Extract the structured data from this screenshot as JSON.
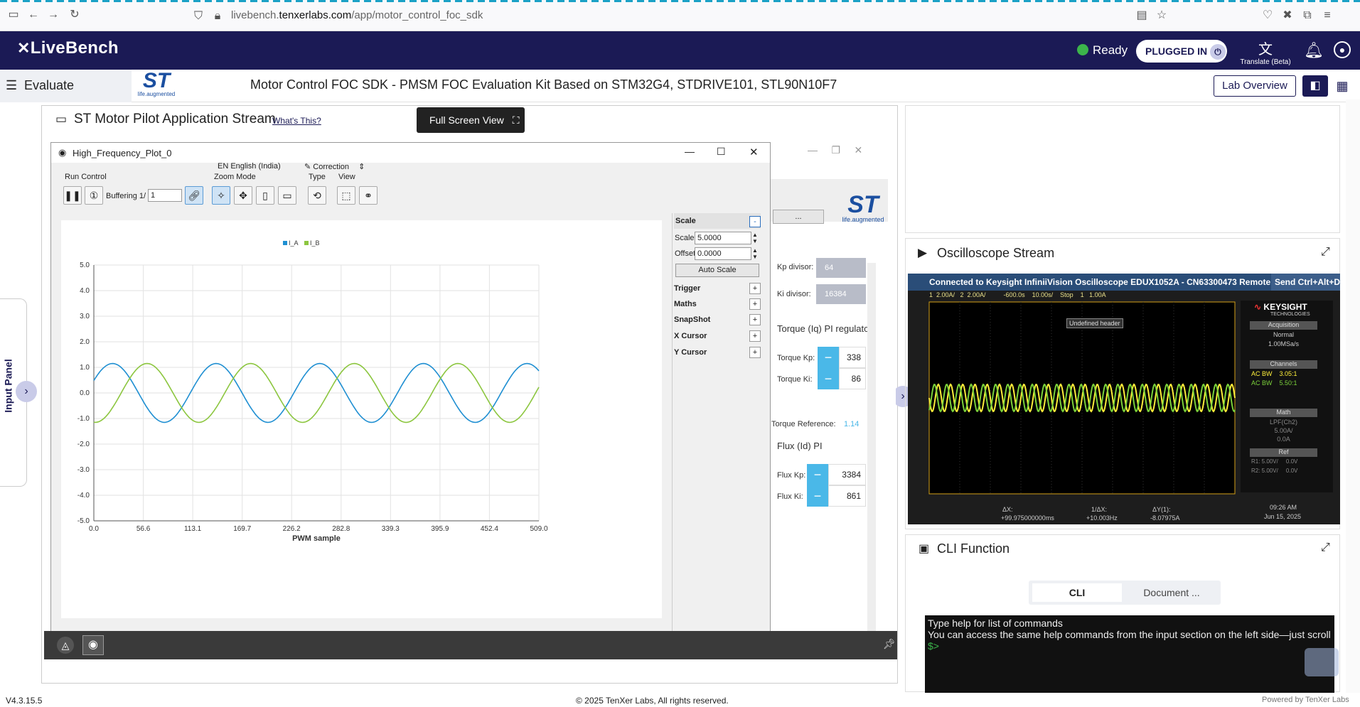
{
  "browser": {
    "url_prefix": "livebench.",
    "url_domain": "tenxerlabs.com",
    "url_path": "/app/motor_control_foc_sdk"
  },
  "header": {
    "logo": "LiveBench",
    "status": "Ready",
    "plugged": "PLUGGED IN",
    "translate": "Translate (Beta)"
  },
  "subheader": {
    "section": "Evaluate",
    "st_tagline": "life.augmented",
    "title": "Motor Control FOC SDK - PMSM FOC Evaluation Kit Based on STM32G4, STDRIVE101, STL90N10F7",
    "lab_overview": "Lab Overview"
  },
  "stream": {
    "title": "ST Motor Pilot Application Stream",
    "whats_this": "What's This?",
    "full_screen": "Full Screen View",
    "input_panel": "Input Panel"
  },
  "plot_window": {
    "title": "High_Frequency_Plot_0",
    "language": "EN English (India)",
    "correction": "Correction",
    "groups": {
      "run": "Run Control",
      "zoom": "Zoom Mode",
      "type": "Type",
      "view": "View"
    },
    "buffering_label": "Buffering 1/",
    "buffering_value": "1",
    "scale_panel": {
      "header": "Scale",
      "scale_label": "Scale",
      "scale_value": "5.0000",
      "offset_label": "Offset",
      "offset_value": "0.0000",
      "auto_scale": "Auto Scale",
      "sections": [
        "Trigger",
        "Maths",
        "SnapShot",
        "X Cursor",
        "Y Cursor"
      ]
    }
  },
  "chart_data": {
    "type": "line",
    "xlabel": "PWM sample",
    "ylabel": "",
    "xlim": [
      0,
      509
    ],
    "ylim": [
      -5,
      5
    ],
    "x_ticks": [
      "0.0",
      "56.6",
      "113.1",
      "169.7",
      "226.2",
      "282.8",
      "339.3",
      "395.9",
      "452.4",
      "509.0"
    ],
    "y_ticks": [
      "5.0",
      "4.0",
      "3.0",
      "2.0",
      "1.0",
      "0.0",
      "-1.0",
      "-2.0",
      "-3.0",
      "-4.0",
      "-5.0"
    ],
    "grid": true,
    "legend": "top-center",
    "series": [
      {
        "name": "I_A",
        "color": "#1f8fd2",
        "amplitude": 1.15,
        "period": 118.5,
        "phase_deg": 25
      },
      {
        "name": "I_B",
        "color": "#8cc63f",
        "amplitude": 1.15,
        "period": 118.5,
        "phase_deg": -95
      }
    ]
  },
  "behind": {
    "kp_divisor_label": "Kp divisor:",
    "kp_divisor": "64",
    "ki_divisor_label": "Ki divisor:",
    "ki_divisor": "16384",
    "torque_pi": "Torque (Iq) PI regulato",
    "torque_kp_label": "Torque Kp:",
    "torque_kp": "338",
    "torque_ki_label": "Torque Ki:",
    "torque_ki": "86",
    "torque_ref_label": "Torque Reference:",
    "torque_ref": "1.14",
    "flux_pi": "Flux (Id) PI",
    "flux_kp_label": "Flux Kp:",
    "flux_kp": "3384",
    "flux_ki_label": "Flux Ki:",
    "flux_ki": "861",
    "st_tagline": "life.augmented",
    "ellipsis": "..."
  },
  "oscilloscope": {
    "title": "Oscilloscope Stream",
    "banner": "Connected to Keysight InfiniiVision Oscilloscope EDUX1052A - CN63300473 Remote",
    "banner_overlap": "Send Ctrl+Alt+Del",
    "top_bar": "1  2.00A/   2  2.00A/          -600.0s    10.00s/    Stop    1   1.00A",
    "brand": "KEYSIGHT",
    "brand_sub": "TECHNOLOGIES",
    "acq_label": "Acquisition",
    "acq_mode": "Normal",
    "acq_rate": "1.00MSa/s",
    "channels_label": "Channels",
    "ch1": "AC BW    3.05:1",
    "ch2": "AC BW    5.50:1",
    "math_label": "Math",
    "math1": "LPF(Ch2)",
    "math2": "5.00A/",
    "math3": "0.0A",
    "ref_label": "Ref",
    "ref1": "R1: 5.00V/     0.0V",
    "ref2": "R2: 5.00V/     0.0V",
    "header_label": "Undefined header",
    "dx": "ΔX:",
    "dx_val": "+99.975000000ms",
    "inv_dx": "1/ΔX:",
    "inv_dx_val": "+10.003Hz",
    "dy": "ΔY(1):",
    "dy_val": "-8.07975A",
    "time": "09:26 AM",
    "date": "Jun 15, 2025"
  },
  "cli": {
    "title": "CLI Function",
    "tab_cli": "CLI",
    "tab_doc": "Document ...",
    "line1": "Type help for list of commands",
    "line2": "You can access the same help commands from the input section on the left side—just scroll",
    "prompt": "$>"
  },
  "footer": {
    "version": "V4.3.15.5",
    "copyright": "© 2025 TenXer Labs, All rights reserved.",
    "powered": "Powered by TenXer Labs"
  },
  "colors": {
    "header_bg": "#1b1a55",
    "accent_blue": "#4ab8e8",
    "ia": "#1f8fd2",
    "ib": "#8cc63f",
    "osc_yellow": "#ffef3a",
    "osc_green": "#7bd23a"
  }
}
